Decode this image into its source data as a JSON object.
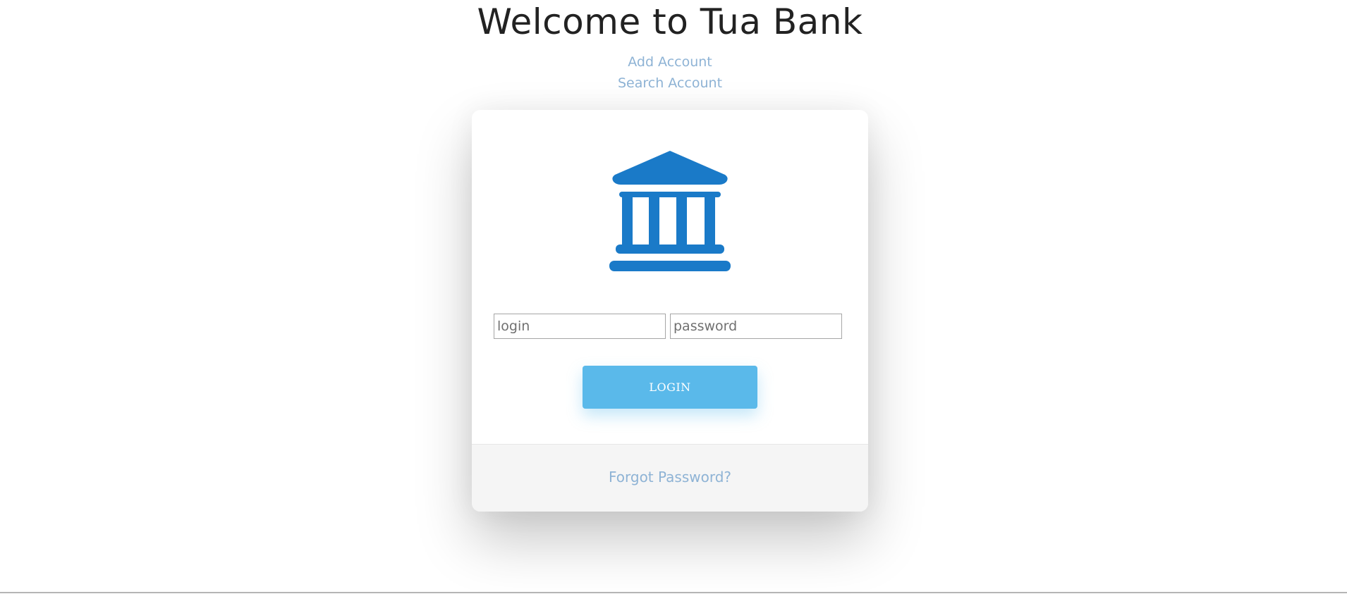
{
  "header": {
    "title": "Welcome to Tua Bank"
  },
  "nav": {
    "add_account": "Add Account",
    "search_account": "Search Account"
  },
  "login_form": {
    "logo_icon": "bank-icon",
    "login_placeholder": "login",
    "login_value": "",
    "password_placeholder": "password",
    "password_value": "",
    "submit_label": "LOGIN"
  },
  "footer": {
    "forgot_password": "Forgot Password?"
  },
  "colors": {
    "accent": "#1a7ac8",
    "button": "#5ab9ea",
    "link": "#8eb3d5",
    "footer_bg": "#f5f5f5"
  }
}
